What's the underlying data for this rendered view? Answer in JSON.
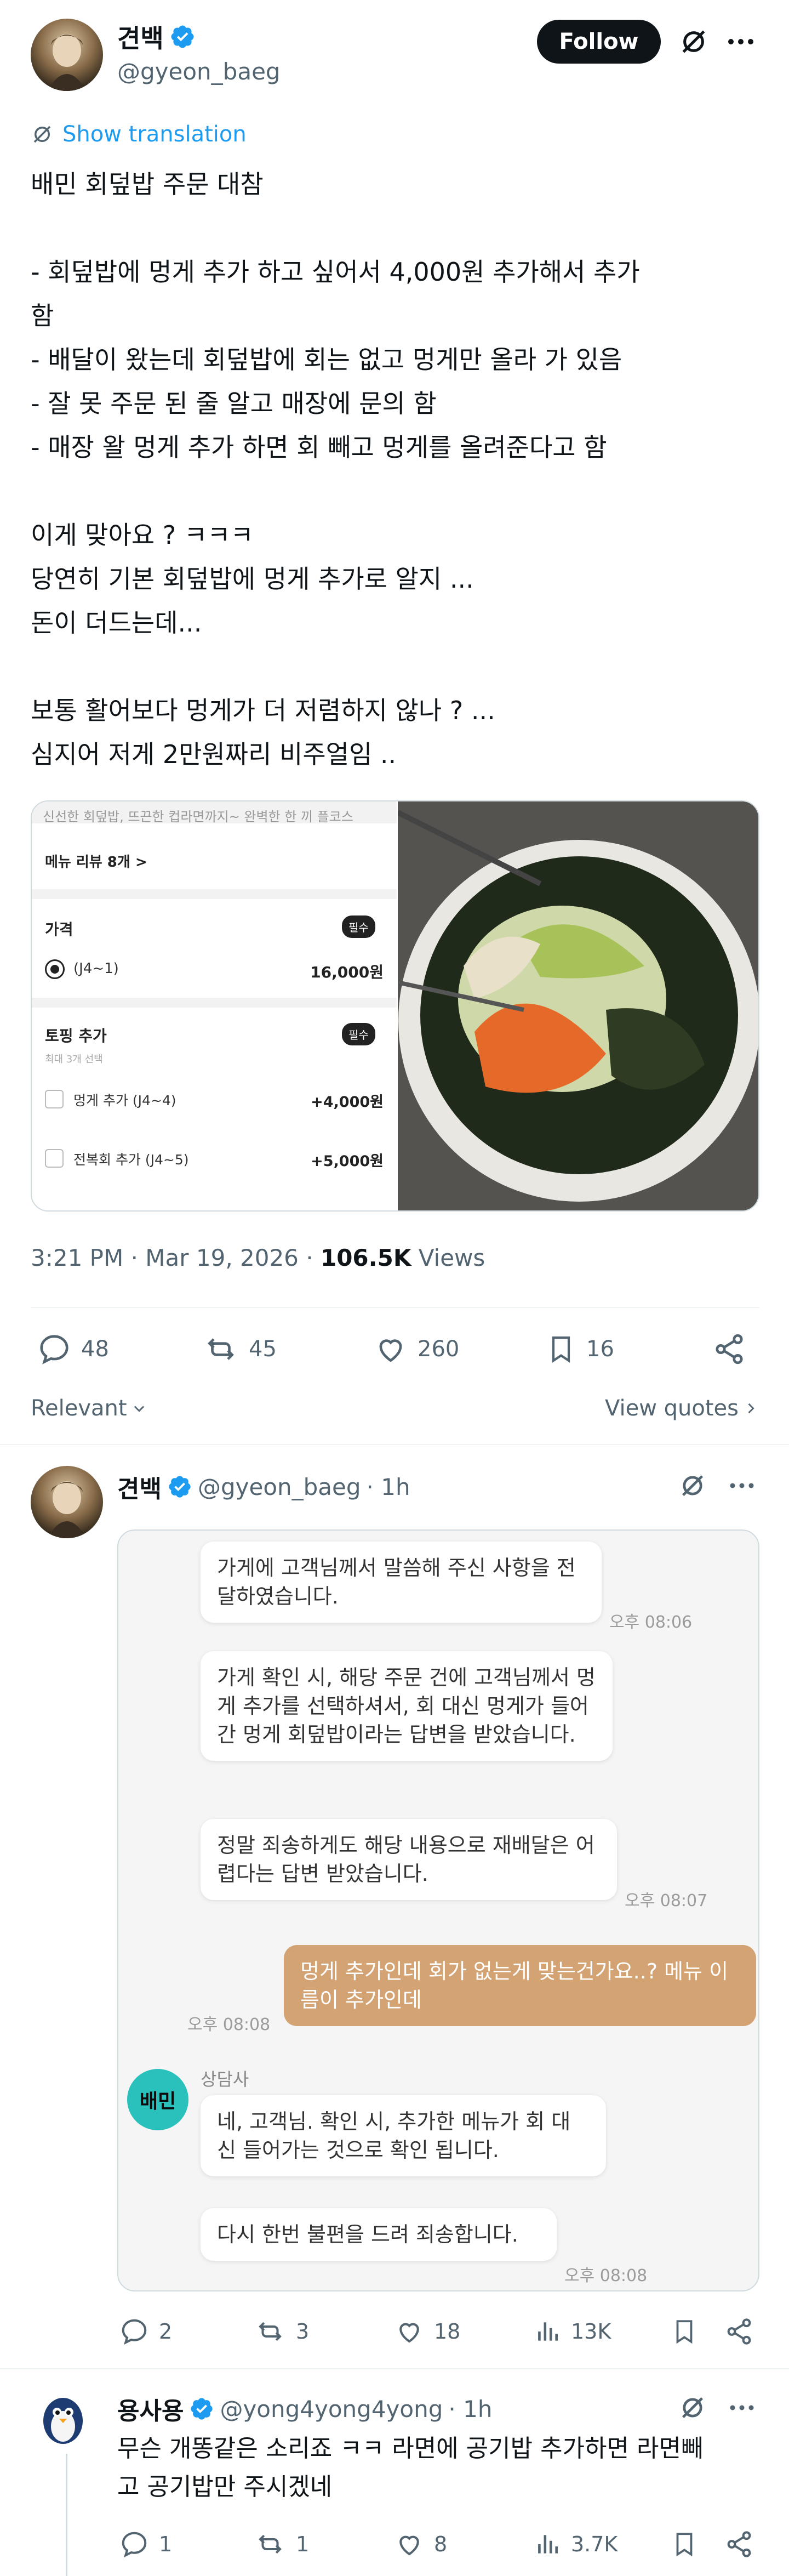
{
  "post": {
    "author_name": "견백",
    "author_handle": "@gyeon_baeg",
    "follow_label": "Follow",
    "show_translation": "Show translation",
    "text_lines": [
      "배민 회덮밥 주문 대참",
      "",
      "- 회덮밥에 멍게 추가 하고 싶어서 4,000원 추가해서 추가",
      "함",
      "- 배달이 왔는데 회덮밥에 회는 없고 멍게만 올라 가 있음",
      "- 잘 못 주문 된 줄 알고 매장에 문의 함",
      "- 매장 왈 멍게 추가 하면 회 빼고 멍게를 올려준다고 함",
      "",
      "이게 맞아요 ? ㅋㅋㅋ",
      "당연히 기본 회덮밥에 멍게 추가로 알지 ...",
      "돈이 더드는데...",
      "",
      "보통 활어보다 멍게가 더 저렴하지 않나 ? ...",
      "심지어 저게 2만원짜리 비주얼임 .."
    ],
    "menu_card": {
      "top_caption": "신선한 회덮밥, 뜨끈한 컵라면까지~ 완벽한 한 끼 플코스",
      "review_label": "메뉴 리뷰 8개 >",
      "price_title": "가격",
      "required_badge": "필수",
      "price_option": "(J4~1)",
      "price_value": "16,000원",
      "topping_title": "토핑 추가",
      "topping_sub": "최대 3개 선택",
      "option1_label": "멍게 추가 (J4~4)",
      "option1_price": "+4,000원",
      "option2_label": "전복회 추가 (J4~5)",
      "option2_price": "+5,000원"
    },
    "timestamp": "3:21 PM · Mar 19, 2026 · ",
    "views_count": "106.5K",
    "views_label": " Views",
    "stats": {
      "replies": "48",
      "reposts": "45",
      "likes": "260",
      "bookmarks": "16"
    }
  },
  "sort": {
    "relevant_label": "Relevant",
    "view_quotes_label": "View quotes"
  },
  "reply1": {
    "author_name": "견백",
    "author_handle": "@gyeon_baeg",
    "time": " · 1h",
    "chat": {
      "msg1": "가게에 고객님께서 말씀해 주신 사항을 전달하였습니다.",
      "ts1": "오후 08:06",
      "msg2": "가게 확인 시, 해당 주문 건에 고객님께서 멍게 추가를 선택하셔서, 회 대신 멍게가 들어간 멍게 회덮밥이라는 답변을 받았습니다.",
      "msg3": "정말 죄송하게도 해당 내용으로 재배달은 어렵다는 답변 받았습니다.",
      "ts3": "오후 08:07",
      "msg4": "멍게 추가인데 회가 없는게 맞는건가요..? 메뉴 이름이 추가인데",
      "ts4": "오후 08:08",
      "agent_logo": "배민",
      "agent_label": "상담사",
      "msg5": "네, 고객님. 확인 시, 추가한 메뉴가 회 대신 들어가는 것으로 확인 됩니다.",
      "msg6": "다시 한번 불편을 드려 죄송합니다.",
      "ts6": "오후 08:08"
    },
    "stats": {
      "replies": "2",
      "reposts": "3",
      "likes": "18",
      "views": "13K"
    }
  },
  "reply2": {
    "author_name": "용사용",
    "author_handle": "@yong4yong4yong",
    "time": " · 1h",
    "text_lines": [
      "무슨 개똥같은 소리죠 ㅋㅋ 라면에 공기밥 추가하면 라면빼",
      "고 공기밥만 주시겠네"
    ],
    "stats": {
      "replies": "1",
      "reposts": "1",
      "likes": "8",
      "views": "3.7K"
    }
  },
  "colors": {
    "verified": "#1d9bf0",
    "link": "#1d9bf0",
    "muted": "#536471",
    "user_bubble": "#d4a373",
    "baemin": "#2ac1bc"
  }
}
